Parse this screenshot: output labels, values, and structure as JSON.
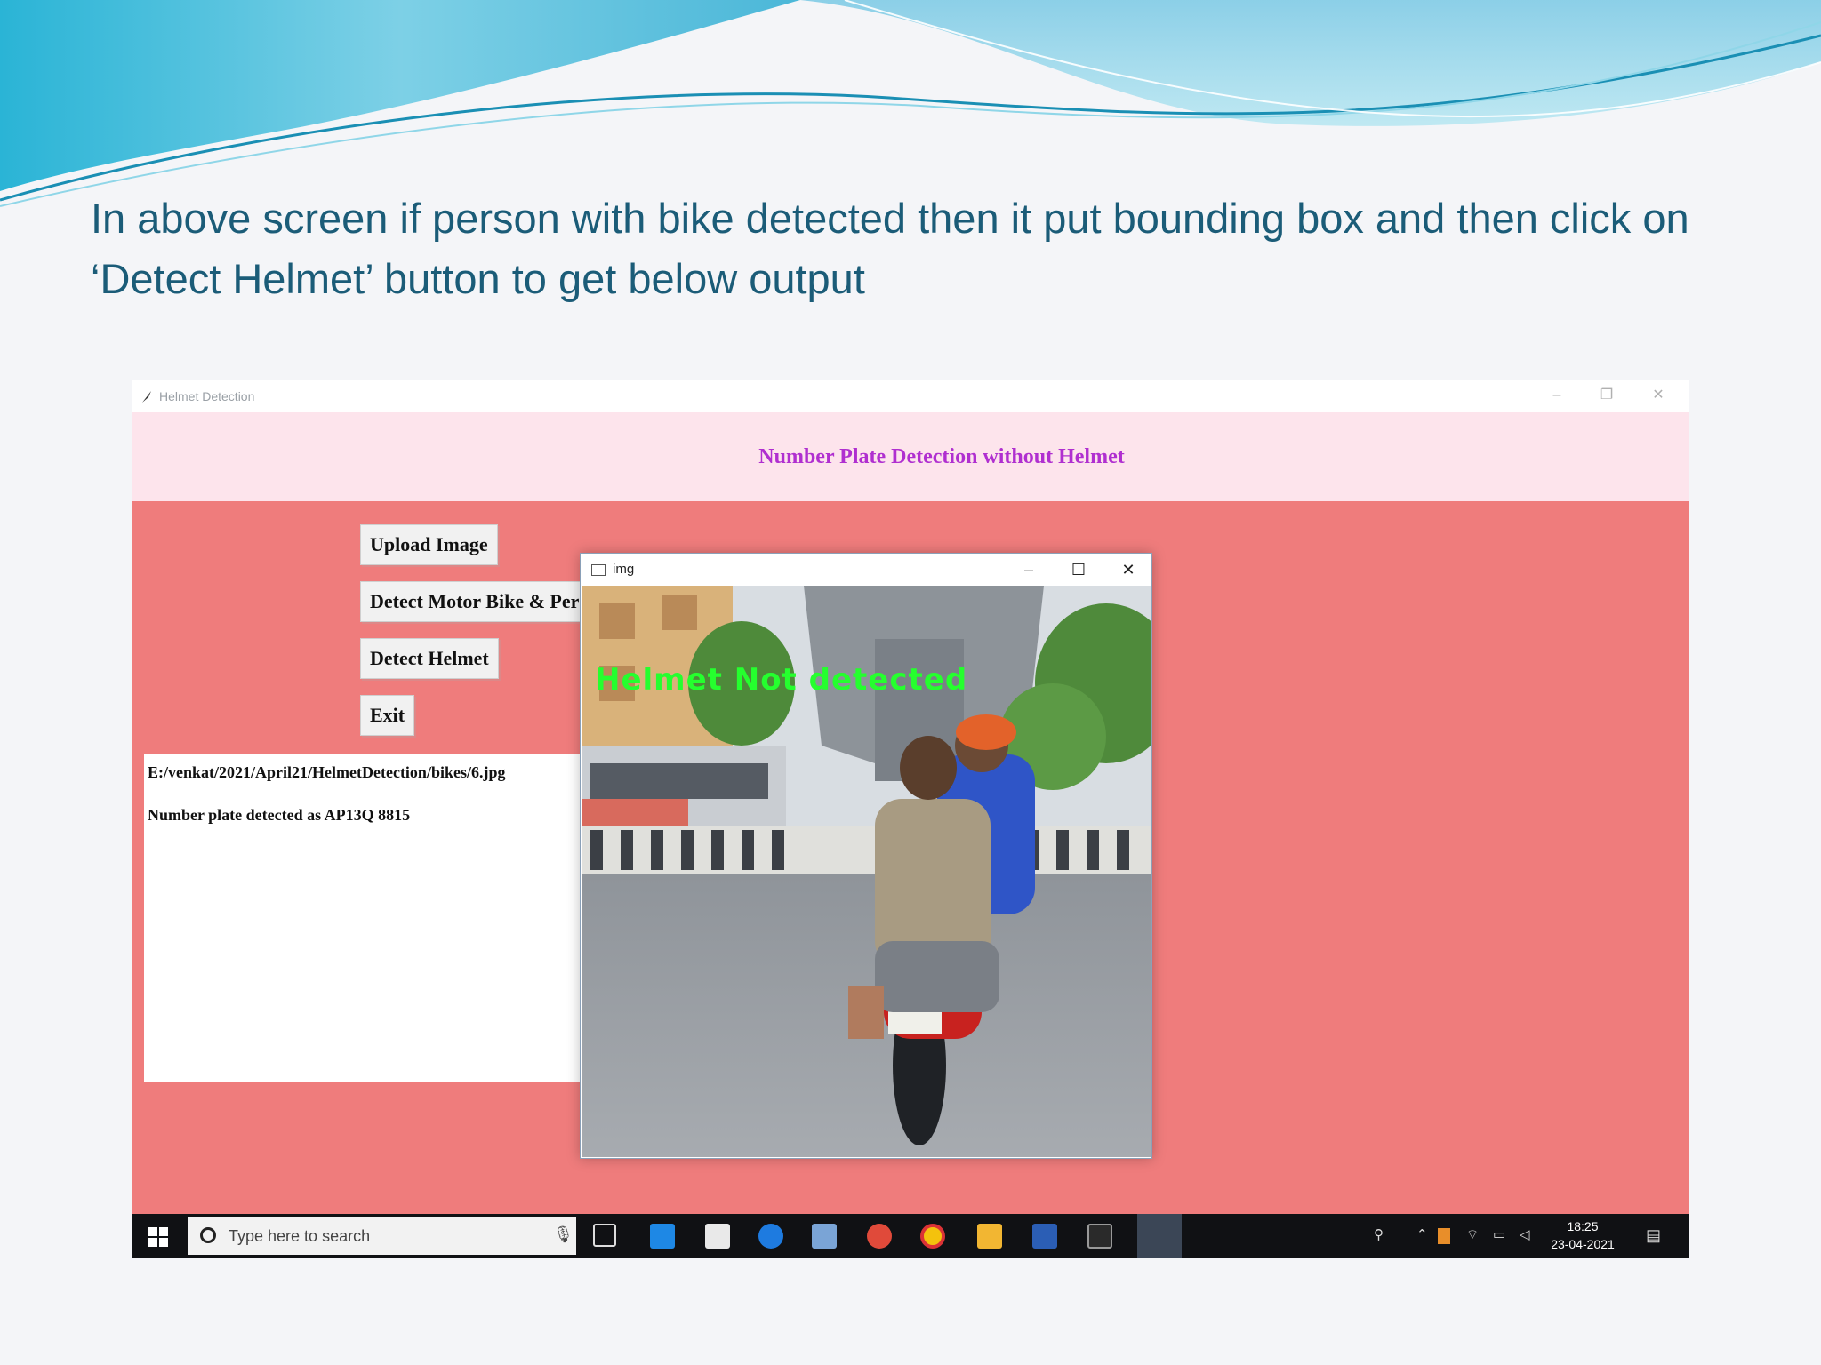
{
  "slide": {
    "caption": "In above screen if person with bike detected then it put bounding box and then click on ‘Detect Helmet’ button to get below output"
  },
  "app_window": {
    "title": "Helmet Detection",
    "controls": {
      "minimize": "–",
      "restore": "❐",
      "close": "✕"
    },
    "heading": "Number Plate Detection without Helmet",
    "buttons": {
      "upload": "Upload Image",
      "detect_bike": "Detect Motor Bike & Person",
      "detect_helmet": "Detect Helmet",
      "exit": "Exit"
    },
    "console": {
      "line1": "E:/venkat/2021/April21/HelmetDetection/bikes/6.jpg",
      "line2": "Number plate detected as AP13Q 8815"
    }
  },
  "image_window": {
    "title": "img",
    "controls": {
      "minimize": "–",
      "maximize": "☐",
      "close": "✕"
    },
    "overlay_text": "Helmet Not detected"
  },
  "taskbar": {
    "search_placeholder": "Type here to search",
    "time": "18:25",
    "date": "23-04-2021"
  },
  "colors": {
    "app_background": "#ef7c7c",
    "header_background": "#fde4ec",
    "heading_text": "#b02fd0",
    "overlay_text": "#25ff2e",
    "caption_text": "#1b5c78"
  },
  "icons": [
    "feather-icon",
    "windows-start-icon",
    "search-icon",
    "microphone-icon",
    "task-view-icon",
    "mail-icon",
    "store-icon",
    "edge-icon",
    "chrome-icon",
    "file-explorer-icon",
    "word-icon",
    "python-icon",
    "notification-icon"
  ]
}
